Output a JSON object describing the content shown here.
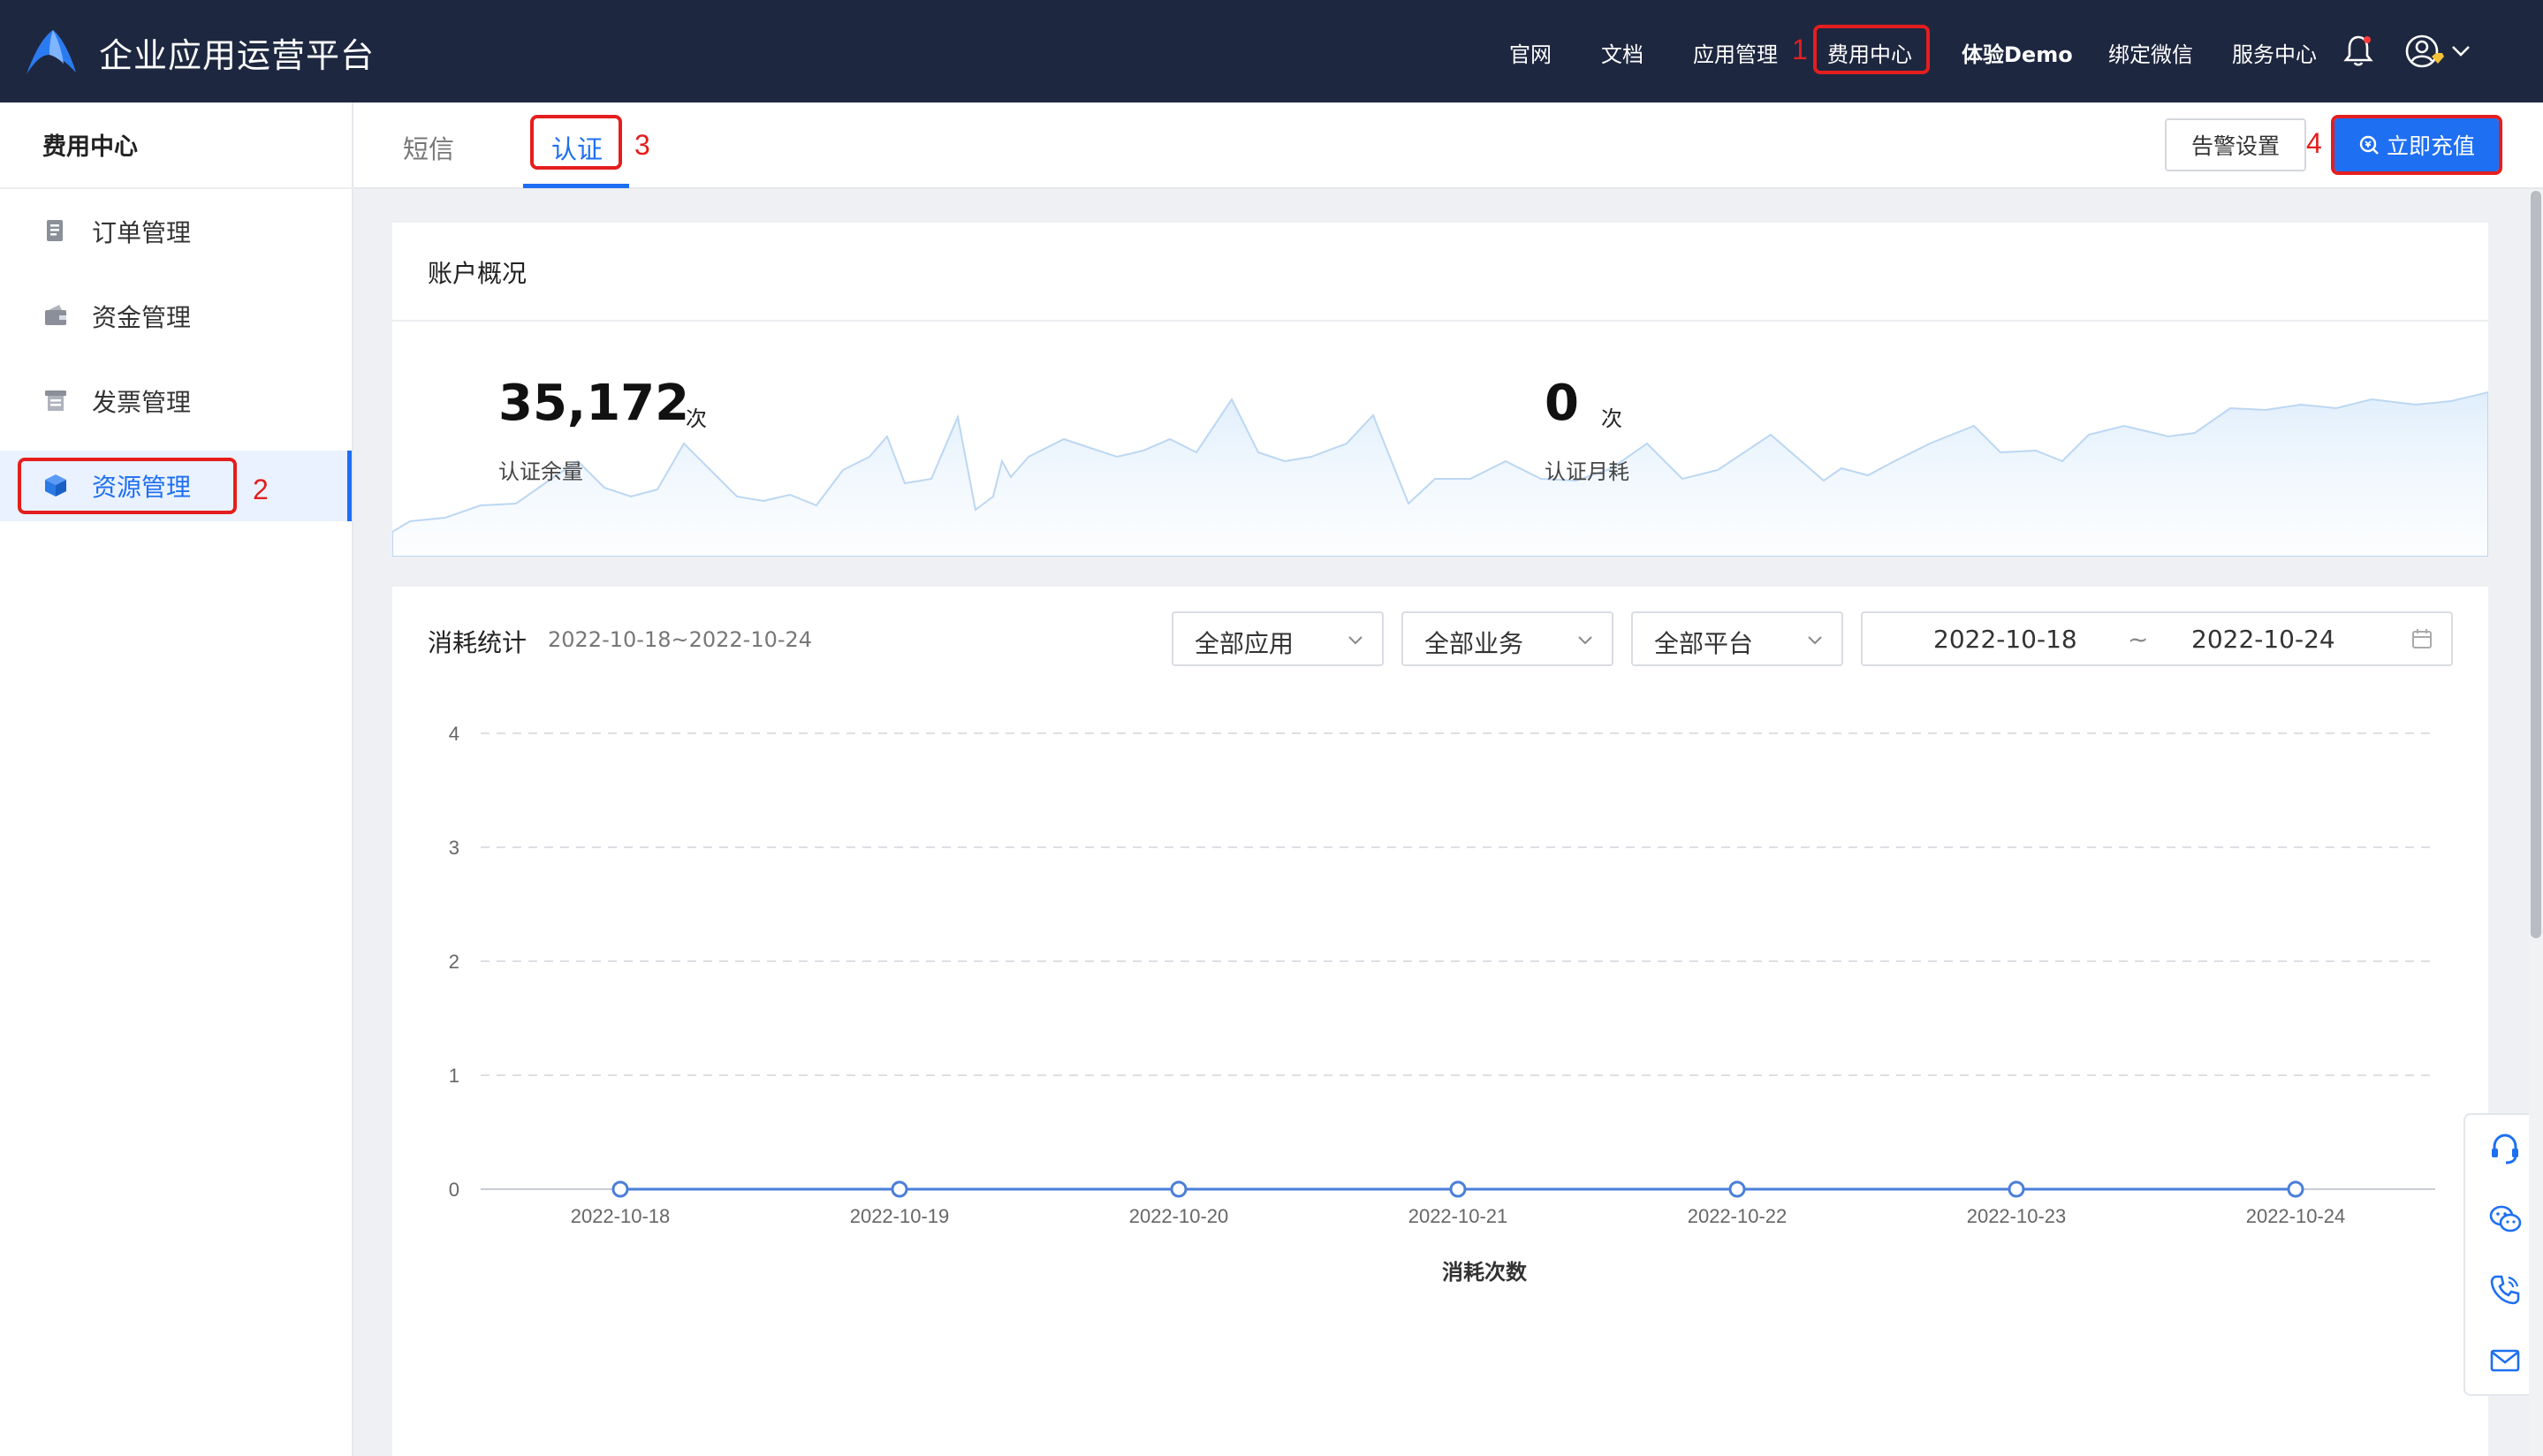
{
  "app": {
    "title": "企业应用运营平台"
  },
  "topnav": {
    "items": [
      "官网",
      "文档",
      "应用管理",
      "费用中心",
      "体验Demo",
      "绑定微信",
      "服务中心"
    ]
  },
  "annotations": [
    "1",
    "2",
    "3",
    "4"
  ],
  "sidebar": {
    "title": "费用中心",
    "items": [
      {
        "label": "订单管理",
        "icon": "order-icon"
      },
      {
        "label": "资金管理",
        "icon": "wallet-icon"
      },
      {
        "label": "发票管理",
        "icon": "invoice-icon"
      },
      {
        "label": "资源管理",
        "icon": "cube-icon"
      }
    ],
    "active_index": 3
  },
  "tabs": {
    "items": [
      "短信",
      "认证"
    ],
    "active_index": 1
  },
  "toolbar": {
    "alert_label": "告警设置",
    "recharge_label": "立即充值"
  },
  "overview": {
    "title": "账户概况",
    "balance": {
      "value": "35,172",
      "unit": "次",
      "label": "认证余量"
    },
    "monthly": {
      "value": "0",
      "unit": "次",
      "label": "认证月耗"
    }
  },
  "consumption": {
    "title": "消耗统计",
    "range": "2022-10-18~2022-10-24",
    "filters": {
      "app": "全部应用",
      "business": "全部业务",
      "platform": "全部平台"
    },
    "date_start": "2022-10-18",
    "date_sep": "~",
    "date_end": "2022-10-24"
  },
  "colors": {
    "accent": "#1e6ff2",
    "topbar": "#1e2740",
    "highlight": "#e41e1e",
    "line": "#4a7fd9"
  },
  "chart_data": {
    "type": "line",
    "x": [
      "2022-10-18",
      "2022-10-19",
      "2022-10-20",
      "2022-10-21",
      "2022-10-22",
      "2022-10-23",
      "2022-10-24"
    ],
    "series": [
      {
        "values": [
          0,
          0,
          0,
          0,
          0,
          0,
          0
        ]
      }
    ],
    "yticks": [
      0,
      1,
      2,
      3,
      4
    ],
    "ylim": [
      0,
      4
    ],
    "xlabel": "消耗次数",
    "grid": true
  }
}
